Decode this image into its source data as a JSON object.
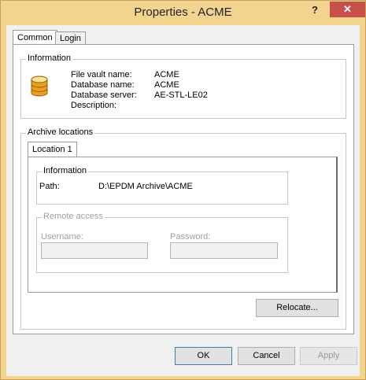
{
  "window": {
    "title": "Properties - ACME",
    "help_glyph": "?",
    "close_glyph": "✕"
  },
  "tabs": [
    {
      "label": "Common",
      "active": true
    },
    {
      "label": "Login",
      "active": false
    }
  ],
  "information": {
    "legend": "Information",
    "fields": [
      {
        "label": "File vault name:",
        "value": "ACME"
      },
      {
        "label": "Database name:",
        "value": "ACME"
      },
      {
        "label": "Database server:",
        "value": "AE-STL-LE02"
      },
      {
        "label": "Description:",
        "value": ""
      }
    ],
    "icon": "database-icon"
  },
  "archive": {
    "legend": "Archive locations",
    "tabs": [
      {
        "label": "Location 1",
        "active": true
      }
    ],
    "information": {
      "legend": "Information",
      "path_label": "Path:",
      "path_value": "D:\\EPDM Archive\\ACME"
    },
    "remote": {
      "legend": "Remote access",
      "username_label": "Username:",
      "password_label": "Password:",
      "username_value": "",
      "password_value": ""
    },
    "relocate_label": "Relocate..."
  },
  "footer": {
    "ok_label": "OK",
    "cancel_label": "Cancel",
    "apply_label": "Apply"
  },
  "colors": {
    "titlebar": "#f3d48f",
    "close": "#c7504b",
    "db_icon": "#e8a020"
  }
}
